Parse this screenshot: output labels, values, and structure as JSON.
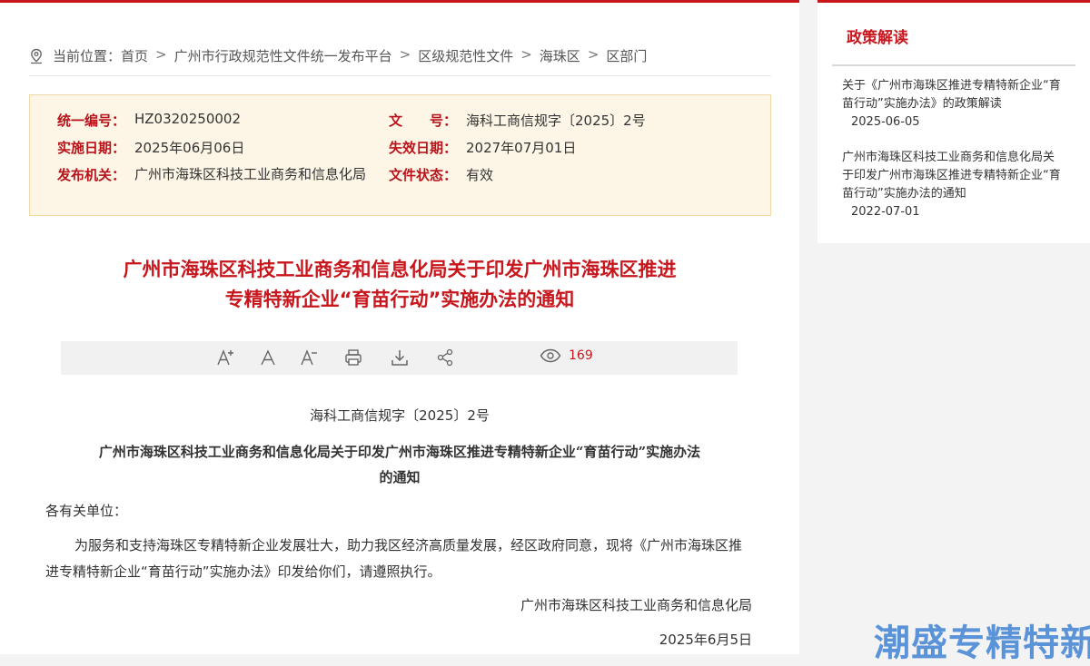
{
  "breadcrumb": {
    "prefix": "当前位置：",
    "items": [
      "首页",
      "广州市行政规范性文件统一发布平台",
      "区级规范性文件",
      "海珠区",
      "区部门"
    ],
    "separator": ">"
  },
  "meta": {
    "code_label": "统一编号：",
    "code_value": "HZ0320250002",
    "docno_label": "文　　号：",
    "docno_value": "海科工商信规字〔2025〕2号",
    "start_label": "实施日期：",
    "start_value": "2025年06月06日",
    "end_label": "失效日期：",
    "end_value": "2027年07月01日",
    "issuer_label": "发布机关：",
    "issuer_value": "广州市海珠区科技工业商务和信息化局",
    "status_label": "文件状态：",
    "status_value": "有效"
  },
  "title": {
    "line1": "广州市海珠区科技工业商务和信息化局关于印发广州市海珠区推进",
    "line2": "专精特新企业“育苗行动”实施办法的通知"
  },
  "toolbar": {
    "icons": [
      "font-increase-icon",
      "font-reset-icon",
      "font-decrease-icon",
      "print-icon",
      "download-icon",
      "share-icon",
      "eye-icon"
    ],
    "views": "169"
  },
  "content": {
    "docno": "海科工商信规字〔2025〕2号",
    "subtitle_line1": "广州市海珠区科技工业商务和信息化局关于印发广州市海珠区推进专精特新企业“育苗行动”实施办法",
    "subtitle_line2": "的通知",
    "greeting": "各有关单位：",
    "paragraph": "为服务和支持海珠区专精特新企业发展壮大，助力我区经济高质量发展，经区政府同意，现将《广州市海珠区推进专精特新企业“育苗行动”实施办法》印发给你们，请遵照执行。",
    "signature": "广州市海珠区科技工业商务和信息化局",
    "date": "2025年6月5日"
  },
  "sidebar": {
    "heading": "政策解读",
    "items": [
      {
        "text": "关于《广州市海珠区推进专精特新企业“育苗行动”实施办法》的政策解读",
        "date": "2025-06-05"
      },
      {
        "text": "广州市海珠区科技工业商务和信息化局关于印发广州市海珠区推进专精特新企业“育苗行动”实施办法的通知",
        "date": "2022-07-01"
      }
    ]
  },
  "watermark": "潮盛专精特新",
  "colors": {
    "accent": "#c8161d",
    "meta_bg": "#fdf6e6",
    "label": "#b8121b"
  }
}
